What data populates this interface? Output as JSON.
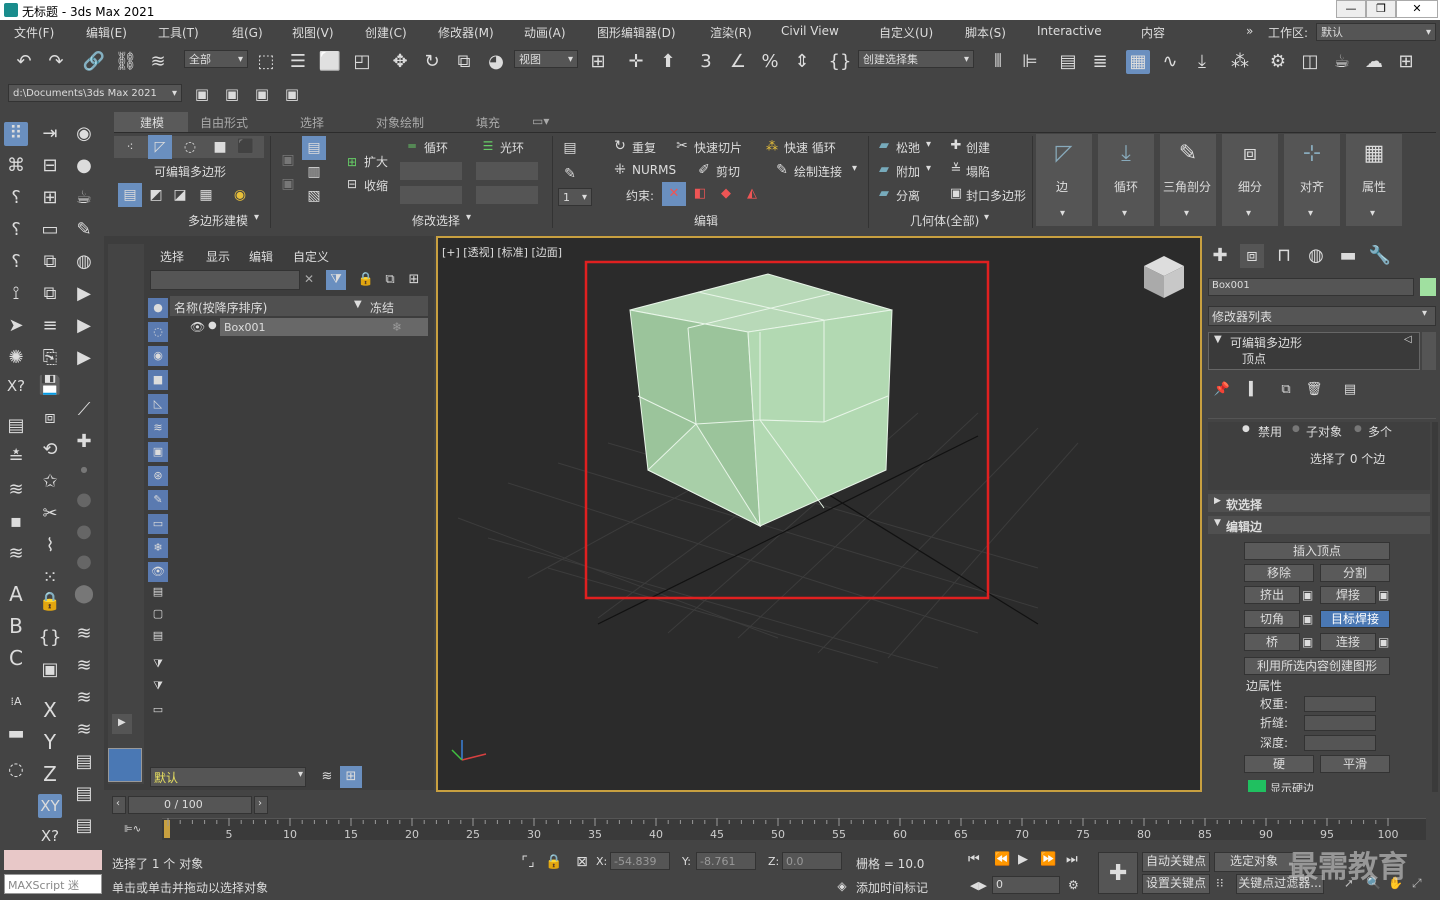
{
  "title": "无标题 - 3ds Max 2021",
  "menu": [
    "文件(F)",
    "编辑(E)",
    "工具(T)",
    "组(G)",
    "视图(V)",
    "创建(C)",
    "修改器(M)",
    "动画(A)",
    "图形编辑器(D)",
    "渲染(R)",
    "Civil View",
    "自定义(U)",
    "脚本(S)",
    "Interactive",
    "内容"
  ],
  "workspace_label": "工作区:",
  "workspace_value": "默认",
  "toolbar": {
    "filter": "全部",
    "view": "视图",
    "selection_set": "创建选择集",
    "path": "d:\\Documents\\3ds Max 2021"
  },
  "ribbon": {
    "tabs": [
      "建模",
      "自由形式",
      "选择",
      "对象绘制",
      "填充"
    ],
    "poly_title": "可编辑多边形",
    "group_poly": "多边形建模",
    "group_modsel": "修改选择",
    "group_edit": "编辑",
    "group_geom": "几何体(全部)",
    "modsel": {
      "expand": "扩大",
      "shrink": "收缩",
      "loop": "循环",
      "ring": "光环"
    },
    "edit": {
      "repeat": "重复",
      "quickslice": "快速切片",
      "quickloop": "快速 循环",
      "nurms": "NURMS",
      "cut": "剪切",
      "paintconnect": "绘制连接",
      "constraint": "约束:",
      "spinner": "1"
    },
    "geom": {
      "relax": "松弛",
      "create": "创建",
      "attach": "附加",
      "collapse": "塌陷",
      "detach": "分离",
      "cap": "封口多边形"
    },
    "big": [
      "边",
      "循环",
      "三角剖分",
      "细分",
      "对齐",
      "属性"
    ]
  },
  "scene": {
    "menu": [
      "选择",
      "显示",
      "编辑",
      "自定义"
    ],
    "col_name": "名称(按降序排序)",
    "col_freeze": "冻结",
    "object": "Box001",
    "layer": "默认"
  },
  "viewport": {
    "label": "[+] [透视] [标准] [边面]"
  },
  "cmd": {
    "object": "Box001",
    "modlist": "修改器列表",
    "stack_root": "可编辑多边形",
    "stack_sub": "顶点",
    "radio": [
      "禁用",
      "子对象",
      "多个"
    ],
    "sel_status": "选择了 0 个边",
    "rollout_soft": "软选择",
    "rollout_edit": "编辑边",
    "insert_vertex": "插入顶点",
    "remove": "移除",
    "split": "分割",
    "extrude": "挤出",
    "weld": "焊接",
    "chamfer": "切角",
    "target_weld": "目标焊接",
    "bridge": "桥",
    "connect": "连接",
    "create_shape": "利用所选内容创建图形",
    "edge_props": "边属性",
    "weight": "权重:",
    "crease": "折缝:",
    "depth": "深度:",
    "hard": "硬",
    "smooth": "平滑",
    "show_hard": "显示硬边"
  },
  "timeline": {
    "frame": "0 / 100",
    "ticks": [
      "0",
      "5",
      "10",
      "15",
      "20",
      "25",
      "30",
      "35",
      "40",
      "45",
      "50",
      "55",
      "60",
      "65",
      "70",
      "75",
      "80",
      "85",
      "90",
      "95",
      "100"
    ]
  },
  "status": {
    "selected": "选择了 1 个 对象",
    "hint": "单击或单击并拖动以选择对象",
    "x_label": "X:",
    "x": "-54.839",
    "y_label": "Y:",
    "y": "-8.761",
    "z_label": "Z:",
    "z": "0.0",
    "grid": "栅格 = 10.0",
    "add_tag": "添加时间标记",
    "autokey": "自动关键点",
    "setkey": "设置关键点",
    "sel_obj": "选定对象",
    "key_filter": "关键点过滤器...",
    "frame_field": "0",
    "maxscript": "MAXScript 迷"
  },
  "watermark": "最需教育"
}
